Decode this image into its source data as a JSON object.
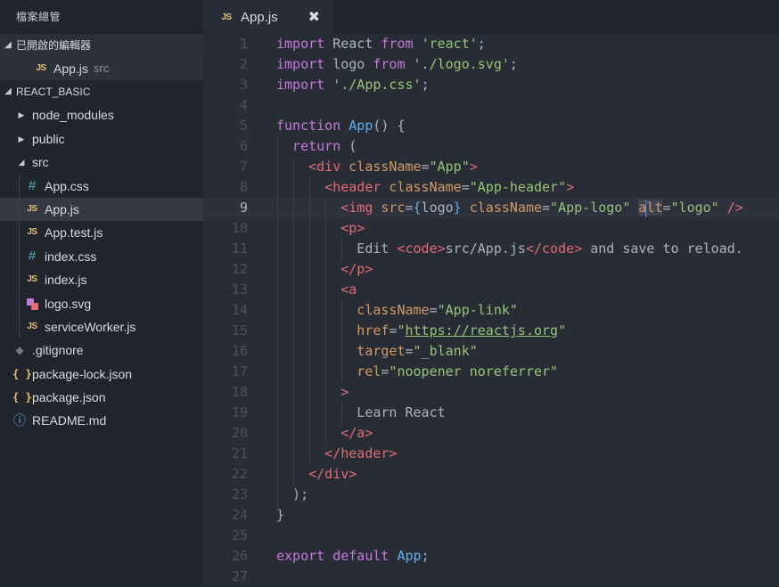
{
  "sidebar": {
    "title": "檔案總管",
    "open_editors": {
      "label": "已開啟的編輯器",
      "file": {
        "name": "App.js",
        "sub": "src",
        "icon": "js-icon"
      }
    },
    "project": {
      "label": "REACT_BASIC",
      "tree": [
        {
          "name": "node_modules",
          "kind": "folder",
          "depth": 1,
          "expanded": false
        },
        {
          "name": "public",
          "kind": "folder",
          "depth": 1,
          "expanded": false
        },
        {
          "name": "src",
          "kind": "folder",
          "depth": 1,
          "expanded": true
        },
        {
          "name": "App.css",
          "kind": "css",
          "depth": 2
        },
        {
          "name": "App.js",
          "kind": "js",
          "depth": 2,
          "selected": true
        },
        {
          "name": "App.test.js",
          "kind": "js",
          "depth": 2
        },
        {
          "name": "index.css",
          "kind": "css",
          "depth": 2
        },
        {
          "name": "index.js",
          "kind": "js",
          "depth": 2
        },
        {
          "name": "logo.svg",
          "kind": "svg",
          "depth": 2
        },
        {
          "name": "serviceWorker.js",
          "kind": "js",
          "depth": 2
        },
        {
          "name": ".gitignore",
          "kind": "git",
          "depth": 1
        },
        {
          "name": "package-lock.json",
          "kind": "json",
          "depth": 1
        },
        {
          "name": "package.json",
          "kind": "json",
          "depth": 1
        },
        {
          "name": "README.md",
          "kind": "info",
          "depth": 1
        }
      ]
    }
  },
  "tab": {
    "label": "App.js",
    "icon_text": "JS",
    "close": "✖"
  },
  "icons": {
    "js": "JS",
    "css": "#",
    "json": "{ }",
    "info": "ⓘ",
    "git": "◆"
  },
  "colors": {
    "keyword": "#c678dd",
    "string": "#98c379",
    "function": "#61afef",
    "tag": "#e06c75",
    "attribute": "#d19a66",
    "text": "#abb2bf",
    "line_number": "#495162",
    "background": "#282c34",
    "sidebar": "#21252b",
    "cursor": "#528bff"
  },
  "editor": {
    "current_line": 9,
    "lines": [
      {
        "n": "1",
        "indent": 0,
        "tokens": [
          [
            "kw",
            "import"
          ],
          [
            "plain",
            " React "
          ],
          [
            "kw",
            "from"
          ],
          [
            "plain",
            " "
          ],
          [
            "str",
            "'react'"
          ],
          [
            "plain",
            ";"
          ]
        ]
      },
      {
        "n": "2",
        "indent": 0,
        "tokens": [
          [
            "kw",
            "import"
          ],
          [
            "plain",
            " logo "
          ],
          [
            "kw",
            "from"
          ],
          [
            "plain",
            " "
          ],
          [
            "str",
            "'./logo.svg'"
          ],
          [
            "plain",
            ";"
          ]
        ]
      },
      {
        "n": "3",
        "indent": 0,
        "tokens": [
          [
            "kw",
            "import"
          ],
          [
            "plain",
            " "
          ],
          [
            "str",
            "'./App.css'"
          ],
          [
            "plain",
            ";"
          ]
        ]
      },
      {
        "n": "4",
        "indent": 0,
        "tokens": []
      },
      {
        "n": "5",
        "indent": 0,
        "tokens": [
          [
            "kw",
            "function"
          ],
          [
            "plain",
            " "
          ],
          [
            "fn",
            "App"
          ],
          [
            "plain",
            "() {"
          ]
        ]
      },
      {
        "n": "6",
        "indent": 1,
        "tokens": [
          [
            "kw",
            "return"
          ],
          [
            "plain",
            " ("
          ]
        ]
      },
      {
        "n": "7",
        "indent": 2,
        "tokens": [
          [
            "tag",
            "<div"
          ],
          [
            "plain",
            " "
          ],
          [
            "attr",
            "className"
          ],
          [
            "plain",
            "="
          ],
          [
            "str",
            "\"App\""
          ],
          [
            "tag",
            ">"
          ]
        ]
      },
      {
        "n": "8",
        "indent": 3,
        "tokens": [
          [
            "tag",
            "<header"
          ],
          [
            "plain",
            " "
          ],
          [
            "attr",
            "className"
          ],
          [
            "plain",
            "="
          ],
          [
            "str",
            "\"App-header\""
          ],
          [
            "tag",
            ">"
          ]
        ]
      },
      {
        "n": "9",
        "indent": 4,
        "tokens": [
          [
            "tag",
            "<img"
          ],
          [
            "plain",
            " "
          ],
          [
            "attr",
            "src"
          ],
          [
            "plain",
            "="
          ],
          [
            "fn",
            "{"
          ],
          [
            "plain",
            "logo"
          ],
          [
            "fn",
            "}"
          ],
          [
            "plain",
            " "
          ],
          [
            "attr",
            "className"
          ],
          [
            "plain",
            "="
          ],
          [
            "str",
            "\"App-logo\""
          ],
          [
            "plain",
            " "
          ],
          [
            "sel",
            "a"
          ],
          [
            "cursor",
            ""
          ],
          [
            "selattr",
            "lt"
          ],
          [
            "plain",
            "="
          ],
          [
            "str",
            "\"logo\""
          ],
          [
            "plain",
            " "
          ],
          [
            "tag",
            "/>"
          ]
        ]
      },
      {
        "n": "10",
        "indent": 4,
        "tokens": [
          [
            "tag",
            "<p>"
          ]
        ]
      },
      {
        "n": "11",
        "indent": 5,
        "tokens": [
          [
            "plain",
            "Edit "
          ],
          [
            "tag",
            "<code>"
          ],
          [
            "plain",
            "src/App.js"
          ],
          [
            "tag",
            "</code>"
          ],
          [
            "plain",
            " and save to reload."
          ]
        ]
      },
      {
        "n": "12",
        "indent": 4,
        "tokens": [
          [
            "tag",
            "</p>"
          ]
        ]
      },
      {
        "n": "13",
        "indent": 4,
        "tokens": [
          [
            "tag",
            "<a"
          ]
        ]
      },
      {
        "n": "14",
        "indent": 5,
        "tokens": [
          [
            "attr",
            "className"
          ],
          [
            "plain",
            "="
          ],
          [
            "str",
            "\"App-link\""
          ]
        ]
      },
      {
        "n": "15",
        "indent": 5,
        "tokens": [
          [
            "attr",
            "href"
          ],
          [
            "plain",
            "="
          ],
          [
            "str",
            "\""
          ],
          [
            "strul",
            "https://reactjs.org"
          ],
          [
            "str",
            "\""
          ]
        ]
      },
      {
        "n": "16",
        "indent": 5,
        "tokens": [
          [
            "attr",
            "target"
          ],
          [
            "plain",
            "="
          ],
          [
            "str",
            "\"_blank\""
          ]
        ]
      },
      {
        "n": "17",
        "indent": 5,
        "tokens": [
          [
            "attr",
            "rel"
          ],
          [
            "plain",
            "="
          ],
          [
            "str",
            "\"noopener noreferrer\""
          ]
        ]
      },
      {
        "n": "18",
        "indent": 4,
        "tokens": [
          [
            "tag",
            ">"
          ]
        ]
      },
      {
        "n": "19",
        "indent": 5,
        "tokens": [
          [
            "plain",
            "Learn React"
          ]
        ]
      },
      {
        "n": "20",
        "indent": 4,
        "tokens": [
          [
            "tag",
            "</a>"
          ]
        ]
      },
      {
        "n": "21",
        "indent": 3,
        "tokens": [
          [
            "tag",
            "</header>"
          ]
        ]
      },
      {
        "n": "22",
        "indent": 2,
        "tokens": [
          [
            "tag",
            "</div>"
          ]
        ]
      },
      {
        "n": "23",
        "indent": 1,
        "tokens": [
          [
            "plain",
            ");"
          ]
        ]
      },
      {
        "n": "24",
        "indent": 0,
        "tokens": [
          [
            "plain",
            "}"
          ]
        ]
      },
      {
        "n": "25",
        "indent": 0,
        "tokens": []
      },
      {
        "n": "26",
        "indent": 0,
        "tokens": [
          [
            "kw",
            "export"
          ],
          [
            "plain",
            " "
          ],
          [
            "kw",
            "default"
          ],
          [
            "plain",
            " "
          ],
          [
            "fn",
            "App"
          ],
          [
            "plain",
            ";"
          ]
        ]
      },
      {
        "n": "27",
        "indent": 0,
        "tokens": []
      }
    ]
  }
}
